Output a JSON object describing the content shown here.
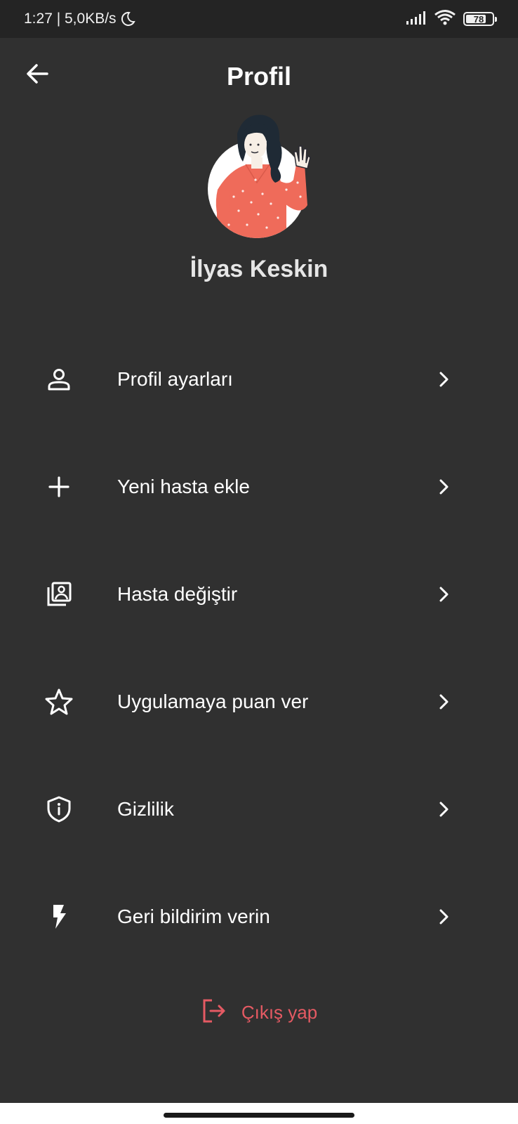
{
  "status_bar": {
    "time_speed": "1:27 | 5,0KB/s",
    "battery": "78",
    "battery_level": 0.78
  },
  "header": {
    "title": "Profil",
    "back_icon": "arrow-left-icon"
  },
  "profile": {
    "name": "İlyas Keskin"
  },
  "menu": {
    "items": [
      {
        "label": "Profil ayarları",
        "icon": "person-icon"
      },
      {
        "label": "Yeni hasta ekle",
        "icon": "plus-icon"
      },
      {
        "label": "Hasta değiştir",
        "icon": "switch-account-icon"
      },
      {
        "label": "Uygulamaya puan ver",
        "icon": "star-icon"
      },
      {
        "label": "Gizlilik",
        "icon": "shield-icon"
      },
      {
        "label": "Geri bildirim verin",
        "icon": "bolt-icon"
      }
    ]
  },
  "logout": {
    "label": "Çıkış yap",
    "color": "#e55a63"
  },
  "colors": {
    "background": "#303030",
    "status_bar": "#242424",
    "accent_red": "#e55a63"
  }
}
